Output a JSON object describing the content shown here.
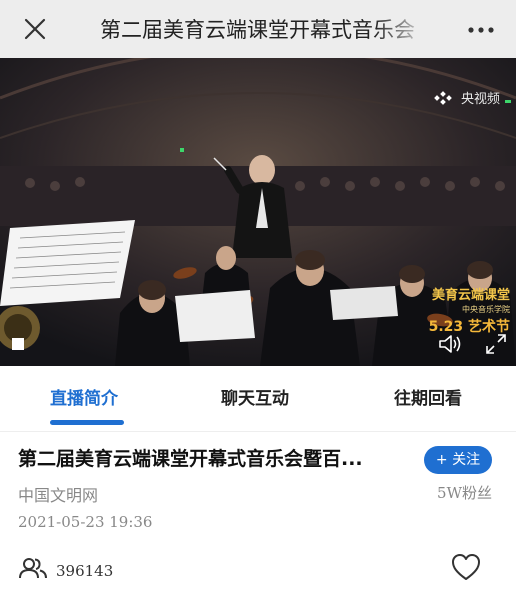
{
  "navbar": {
    "title": "第二届美育云端课堂开幕式音乐会",
    "close_icon": "close-icon",
    "more_icon": "more-dots-icon"
  },
  "video": {
    "watermark": "央视频",
    "badge_line1": "美育云端课堂",
    "badge_line2": "中央音乐学院",
    "badge_line3": "5.23 艺术节",
    "volume_icon": "volume-icon",
    "fullscreen_icon": "fullscreen-icon"
  },
  "tabs": [
    {
      "label": "直播简介",
      "active": true
    },
    {
      "label": "聊天互动",
      "active": false
    },
    {
      "label": "往期回看",
      "active": false
    }
  ],
  "info": {
    "title": "第二届美育云端课堂开幕式音乐会暨百...",
    "follow_label": "+ 关注",
    "source": "中国文明网",
    "fans": "5W粉丝",
    "datetime": "2021-05-23 19:36",
    "viewers": "396143"
  },
  "colors": {
    "accent": "#1f6fd1",
    "navbar_bg": "#ededed",
    "muted_text": "#888888"
  }
}
